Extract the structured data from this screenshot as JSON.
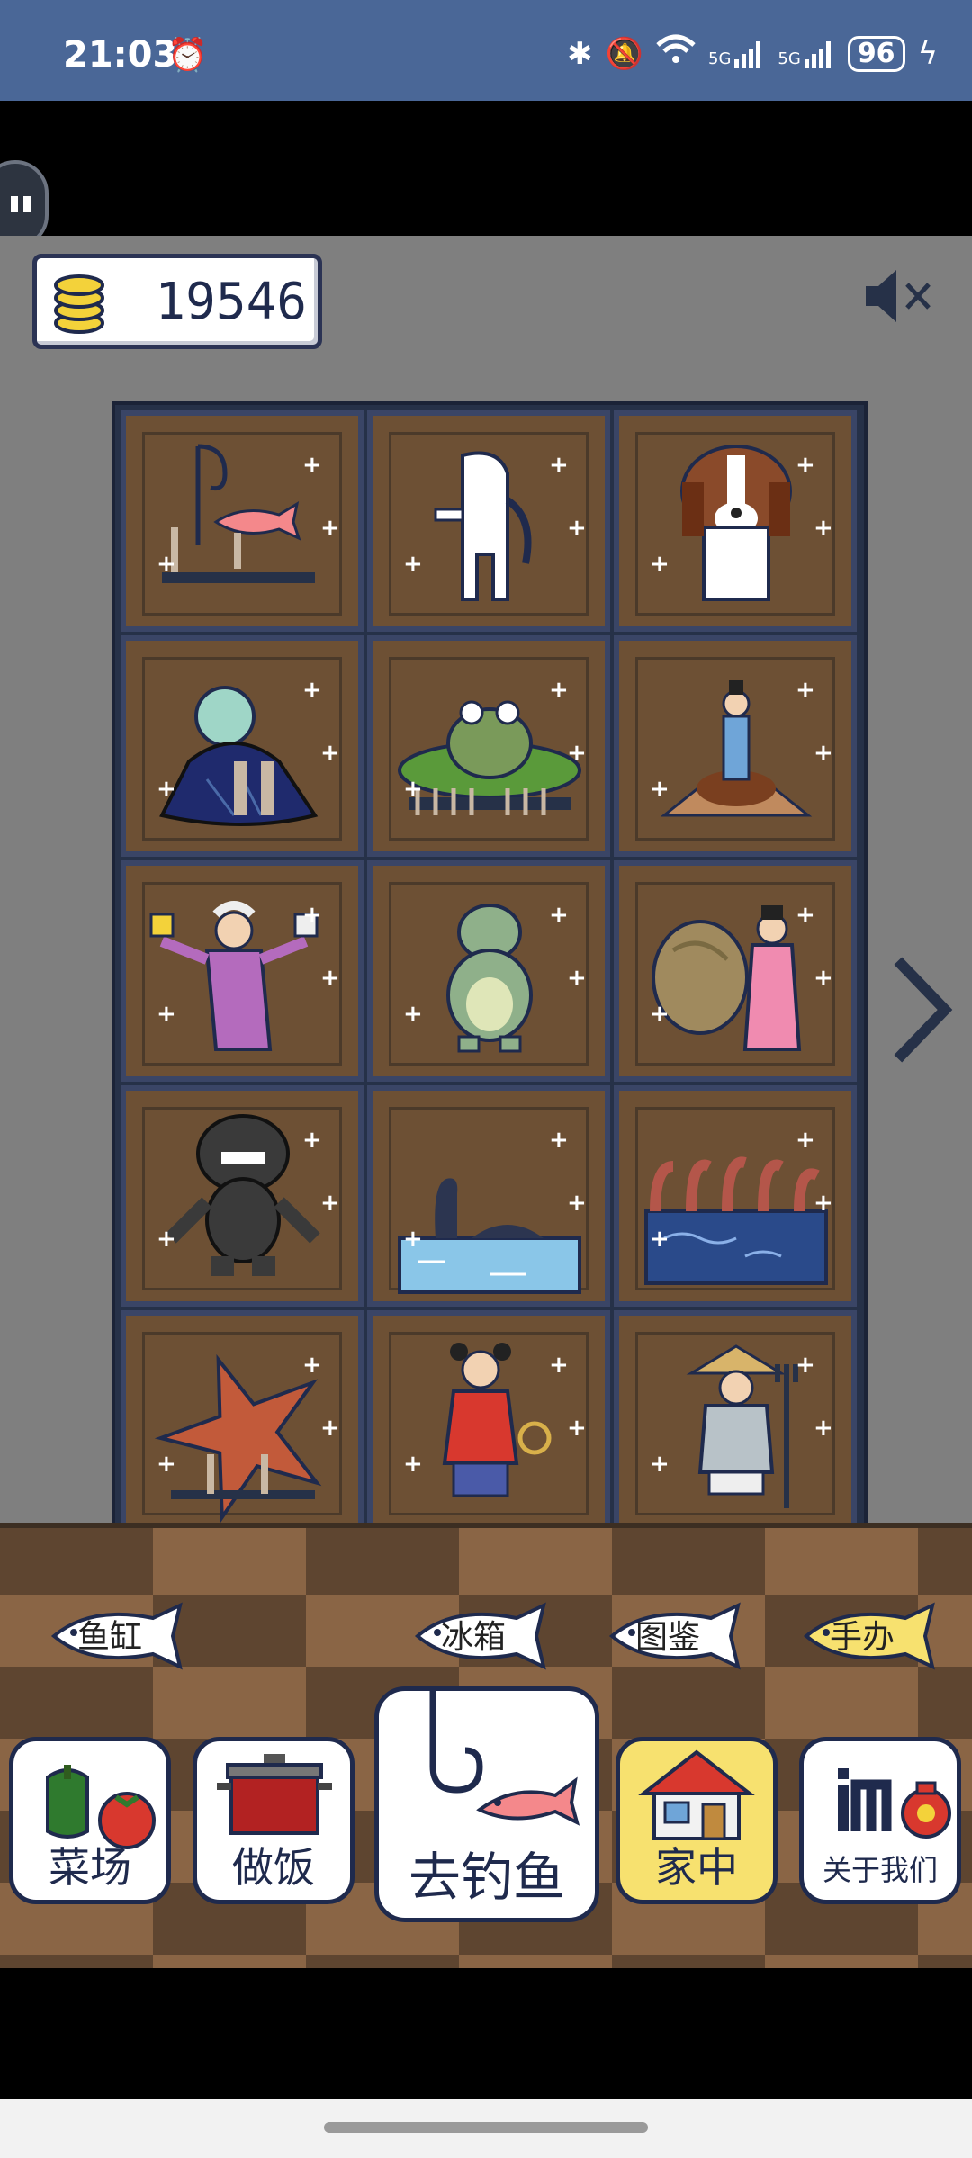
{
  "status_bar": {
    "time": "21:03",
    "battery": "96",
    "network_1": "5G",
    "network_2": "5G",
    "icons": [
      "alarm-icon",
      "bluetooth-icon",
      "mute-icon",
      "wifi-icon",
      "signal-icon",
      "charging-icon"
    ]
  },
  "hud": {
    "coins": "19546",
    "coin_icon": "coin-stack-icon",
    "sound_icon": "speaker-muted-icon"
  },
  "cabinet": {
    "cells": [
      {
        "name": "fish-on-hook-figure"
      },
      {
        "name": "white-creature-figure"
      },
      {
        "name": "beagle-dog-figure"
      },
      {
        "name": "mermaid-figure"
      },
      {
        "name": "frog-on-lotus-figure"
      },
      {
        "name": "lady-on-pedestal-figure"
      },
      {
        "name": "axe-holder-figure"
      },
      {
        "name": "green-frog-figure"
      },
      {
        "name": "shell-maiden-figure"
      },
      {
        "name": "black-monster-figure"
      },
      {
        "name": "lake-monster-figure"
      },
      {
        "name": "octopus-tank-figure"
      },
      {
        "name": "starfish-figure"
      },
      {
        "name": "nezha-figure"
      },
      {
        "name": "fisherman-figure"
      }
    ]
  },
  "sub_tabs": [
    {
      "label": "鱼缸",
      "active": false
    },
    {
      "label": "冰箱",
      "active": false
    },
    {
      "label": "图鉴",
      "active": false
    },
    {
      "label": "手办",
      "active": true
    }
  ],
  "nav": [
    {
      "label": "菜场",
      "active": false
    },
    {
      "label": "做饭",
      "active": false
    },
    {
      "label": "去钓鱼",
      "active": false
    },
    {
      "label": "家中",
      "active": true
    },
    {
      "label": "关于我们",
      "active": false
    }
  ],
  "colors": {
    "status_bar": "#4a6797",
    "wall": "#7f7f7f",
    "cabinet": "#263148",
    "shelf": "#6d5034",
    "floor_light": "#8a6545",
    "floor_dark": "#5e4530",
    "active_tab": "#f7e16f"
  }
}
